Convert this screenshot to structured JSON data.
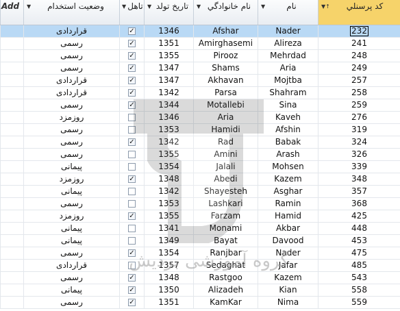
{
  "header": {
    "add_label": "Add",
    "columns": [
      {
        "key": "code",
        "label": "کد پرسنلي"
      },
      {
        "key": "name",
        "label": "نام"
      },
      {
        "key": "family",
        "label": "نام خانوادگي"
      },
      {
        "key": "birth",
        "label": "تاريخ تولد"
      },
      {
        "key": "married",
        "label": "تاهل"
      },
      {
        "key": "status",
        "label": "وضعيت استخدام"
      }
    ]
  },
  "rows": [
    {
      "code": "232",
      "name": "Nader",
      "family": "Afshar",
      "birth": "1346",
      "married": true,
      "status": "قراردادی",
      "active": true
    },
    {
      "code": "241",
      "name": "Alireza",
      "family": "Amirghasemi",
      "birth": "1351",
      "married": true,
      "status": "رسمی"
    },
    {
      "code": "248",
      "name": "Mehrdad",
      "family": "Pirooz",
      "birth": "1355",
      "married": true,
      "status": "رسمی"
    },
    {
      "code": "249",
      "name": "Aria",
      "family": "Shams",
      "birth": "1347",
      "married": true,
      "status": "رسمی"
    },
    {
      "code": "257",
      "name": "Mojtba",
      "family": "Akhavan",
      "birth": "1347",
      "married": true,
      "status": "قراردادی"
    },
    {
      "code": "258",
      "name": "Shahram",
      "family": "Parsa",
      "birth": "1342",
      "married": true,
      "status": "قراردادی"
    },
    {
      "code": "259",
      "name": "Sina",
      "family": "Motallebi",
      "birth": "1344",
      "married": true,
      "status": "رسمی"
    },
    {
      "code": "276",
      "name": "Kaveh",
      "family": "Aria",
      "birth": "1346",
      "married": false,
      "status": "روزمزد"
    },
    {
      "code": "319",
      "name": "Afshin",
      "family": "Hamidi",
      "birth": "1353",
      "married": false,
      "status": "رسمی"
    },
    {
      "code": "324",
      "name": "Babak",
      "family": "Rad",
      "birth": "1342",
      "married": true,
      "status": "رسمی"
    },
    {
      "code": "326",
      "name": "Arash",
      "family": "Amini",
      "birth": "1355",
      "married": false,
      "status": "رسمی"
    },
    {
      "code": "339",
      "name": "Mohsen",
      "family": "Jalali",
      "birth": "1354",
      "married": false,
      "status": "پیمانی"
    },
    {
      "code": "348",
      "name": "Kazem",
      "family": "Abedi",
      "birth": "1348",
      "married": true,
      "status": "روزمزد"
    },
    {
      "code": "357",
      "name": "Asghar",
      "family": "Shayesteh",
      "birth": "1342",
      "married": false,
      "status": "پیمانی"
    },
    {
      "code": "368",
      "name": "Ramin",
      "family": "Lashkari",
      "birth": "1353",
      "married": false,
      "status": "رسمی"
    },
    {
      "code": "425",
      "name": "Hamid",
      "family": "Farzam",
      "birth": "1355",
      "married": true,
      "status": "روزمزد"
    },
    {
      "code": "448",
      "name": "Akbar",
      "family": "Monami",
      "birth": "1341",
      "married": false,
      "status": "پیمانی"
    },
    {
      "code": "453",
      "name": "Davood",
      "family": "Bayat",
      "birth": "1349",
      "married": false,
      "status": "پیمانی"
    },
    {
      "code": "475",
      "name": "Nader",
      "family": "Ranjbar",
      "birth": "1354",
      "married": true,
      "status": "رسمی"
    },
    {
      "code": "485",
      "name": "Jafar",
      "family": "Sedaghat",
      "birth": "1357",
      "married": false,
      "status": "قراردادی"
    },
    {
      "code": "543",
      "name": "Kazem",
      "family": "Rastgoo",
      "birth": "1348",
      "married": true,
      "status": "رسمی"
    },
    {
      "code": "558",
      "name": "Kian",
      "family": "Alizadeh",
      "birth": "1350",
      "married": true,
      "status": "پیمانی"
    },
    {
      "code": "559",
      "name": "Nima",
      "family": "KamKar",
      "birth": "1351",
      "married": true,
      "status": "رسمی"
    }
  ],
  "watermark": {
    "text": "گروه آموزشی بردیش"
  },
  "colors": {
    "selected_header": "#f6d36a",
    "active_row": "#b9d9f5",
    "grid_line": "#e3e7ec"
  }
}
